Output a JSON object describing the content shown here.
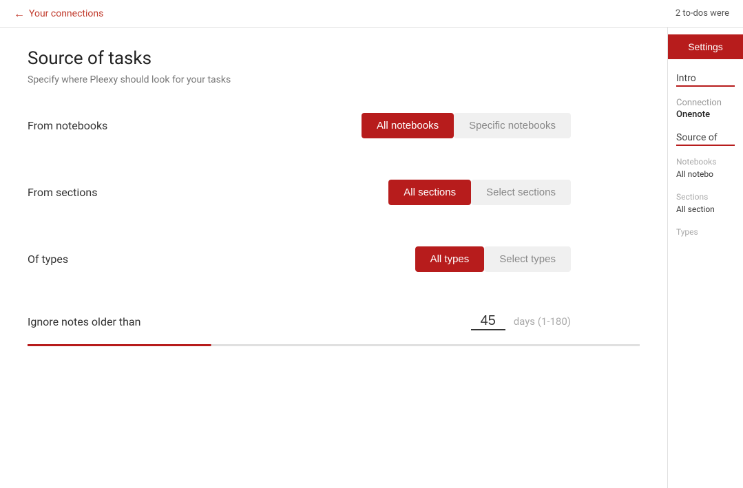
{
  "topbar": {
    "back_label": "Your connections",
    "notification": "2 to-dos were"
  },
  "page": {
    "title": "Source of tasks",
    "subtitle": "Specify where Pleexy should look for your tasks"
  },
  "form": {
    "notebooks_label": "From notebooks",
    "notebooks_active_btn": "All notebooks",
    "notebooks_inactive_btn": "Specific notebooks",
    "sections_label": "From sections",
    "sections_active_btn": "All sections",
    "sections_inactive_btn": "Select sections",
    "types_label": "Of types",
    "types_active_btn": "All types",
    "types_inactive_btn": "Select types",
    "ignore_label": "Ignore notes older than",
    "ignore_value": "45",
    "ignore_hint": "days (1-180)"
  },
  "sidebar": {
    "settings_btn": "Settings",
    "intro_label": "Intro",
    "connection_label": "Connection",
    "connection_value": "Onenote",
    "source_label": "Source of",
    "notebooks_label": "Notebooks",
    "notebooks_value": "All notebo",
    "sections_label": "Sections",
    "sections_value": "All section",
    "types_label": "Types"
  }
}
